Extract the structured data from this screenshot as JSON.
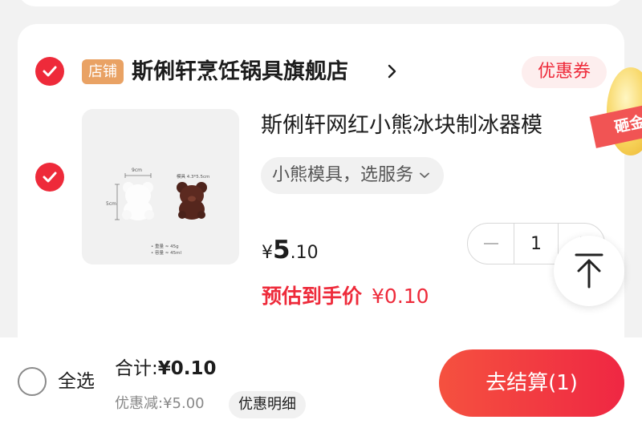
{
  "colors": {
    "accent": "#ee2a3a",
    "store_tag": "#e9a264",
    "coupon_bg": "#fdeeee"
  },
  "store": {
    "tag": "店铺",
    "name": "斯俐轩烹饪锅具旗舰店",
    "coupon_label": "优惠券",
    "promo_text": "砸金"
  },
  "item": {
    "title": "斯俐轩网红小熊冰块制冰器模",
    "spec": "小熊模具，选服务",
    "price_symbol": "¥",
    "price_int": "5",
    "price_dec": ".10",
    "estimate_label": "预估到手价",
    "estimate_price": "¥0.10",
    "quantity": "1",
    "image": {
      "width_label": "9cm",
      "height_label": "5cm",
      "size_label": "模具 4.3*5.5cm",
      "note1": "• 重量 ≈ 45g",
      "note2": "• 容量 ≈ 45ml"
    }
  },
  "footer": {
    "select_all": "全选",
    "total_label": "合计:",
    "total_value": "¥0.10",
    "discount": "优惠减:¥5.00",
    "detail_button": "优惠明细",
    "checkout_button": "去结算(1)"
  }
}
